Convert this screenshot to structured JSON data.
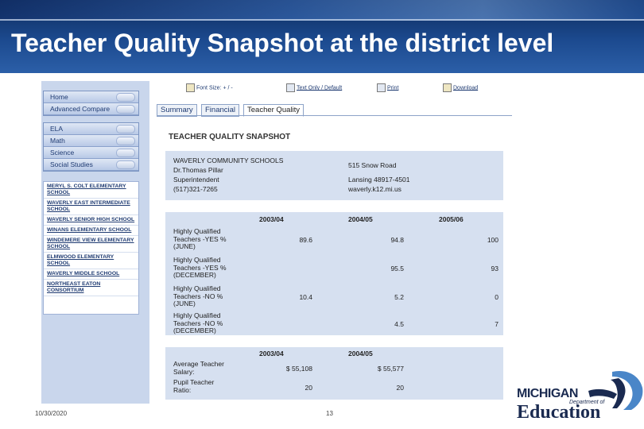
{
  "slide": {
    "title": "Teacher Quality Snapshot at the district level",
    "date": "10/30/2020",
    "page_number": "13"
  },
  "logo": {
    "line1": "MICHIGAN",
    "dept": "Department of",
    "line2": "Education",
    "colors": {
      "navy": "#1a2a50",
      "blue": "#4a86c8"
    }
  },
  "nav": {
    "top_items": [
      "Home",
      "Advanced Compare"
    ],
    "subjects": [
      "ELA",
      "Math",
      "Science",
      "Social Studies"
    ],
    "schools": [
      "MERYL S. COLT ELEMENTARY SCHOOL",
      "WAVERLY EAST INTERMEDIATE SCHOOL",
      "WAVERLY SENIOR HIGH SCHOOL",
      "WINANS ELEMENTARY SCHOOL",
      "WINDEMERE VIEW ELEMENTARY SCHOOL",
      "ELMWOOD ELEMENTARY SCHOOL",
      "WAVERLY MIDDLE SCHOOL",
      "NORTHEAST EATON CONSORTIUM"
    ]
  },
  "toolbar": {
    "font_size": "Font Size: + / -",
    "text_only": "Text Only / Default",
    "print": "Print",
    "download": "Download"
  },
  "tabs": [
    {
      "label": "Summary",
      "active": false
    },
    {
      "label": "Financial",
      "active": false
    },
    {
      "label": "Teacher Quality",
      "active": true
    }
  ],
  "snapshot": {
    "heading": "TEACHER QUALITY SNAPSHOT",
    "district": "WAVERLY COMMUNITY SCHOOLS",
    "person": "Dr.Thomas Pillar",
    "role": "Superintendent",
    "phone": "(517)321-7265",
    "address": "515 Snow Road",
    "city": "Lansing 48917-4501",
    "website": "waverly.k12.mi.us"
  },
  "quality_table": {
    "years": [
      "2003/04",
      "2004/05",
      "2005/06"
    ],
    "rows": [
      {
        "label": "Highly Qualified Teachers -YES % (JUNE)",
        "values": [
          "89.6",
          "94.8",
          "100"
        ]
      },
      {
        "label": "Highly Qualified Teachers -YES % (DECEMBER)",
        "values": [
          "",
          "95.5",
          "93"
        ]
      },
      {
        "label": "Highly Qualified Teachers -NO % (JUNE)",
        "values": [
          "10.4",
          "5.2",
          "0"
        ]
      },
      {
        "label": "Highly Qualified Teachers -NO % (DECEMBER)",
        "values": [
          "",
          "4.5",
          "7"
        ]
      }
    ]
  },
  "salary_table": {
    "years": [
      "2003/04",
      "2004/05"
    ],
    "rows": [
      {
        "label": "Average Teacher Salary:",
        "values": [
          "$ 55,108",
          "$ 55,577"
        ]
      },
      {
        "label": "Pupil Teacher Ratio:",
        "values": [
          "20",
          "20"
        ]
      }
    ]
  }
}
